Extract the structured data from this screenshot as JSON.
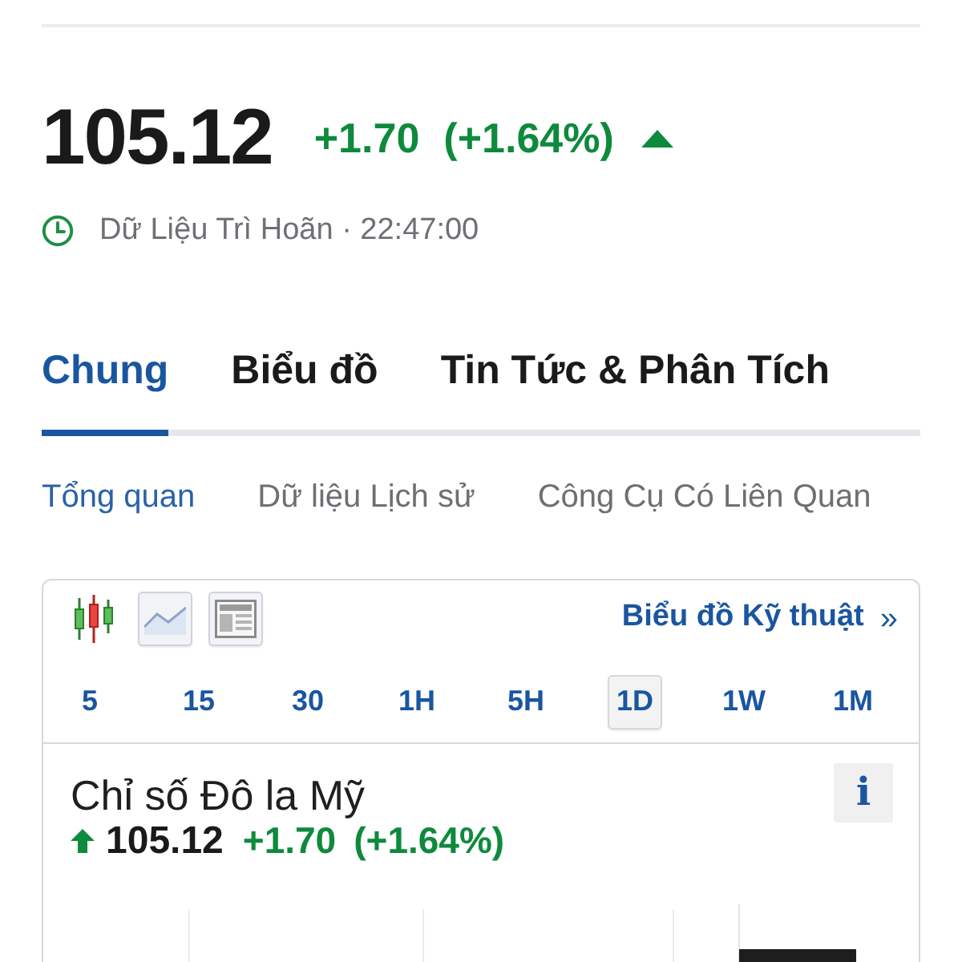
{
  "quote": {
    "price": "105.12",
    "change": "+1.70",
    "change_percent": "(+1.64%)",
    "rising": true
  },
  "status": {
    "label": "Dữ Liệu Trì Hoãn · 22:47:00"
  },
  "tabs": [
    {
      "label": "Chung",
      "selected": true
    },
    {
      "label": "Biểu đồ",
      "selected": false
    },
    {
      "label": "Tin Tức & Phân Tích",
      "selected": false
    }
  ],
  "subtabs": [
    {
      "label": "Tổng quan",
      "selected": true
    },
    {
      "label": "Dữ liệu Lịch sử",
      "selected": false
    },
    {
      "label": "Công Cụ Có Liên Quan",
      "selected": false
    }
  ],
  "chart_widget": {
    "chart_types": [
      {
        "kind": "candlestick",
        "selected": false
      },
      {
        "kind": "line",
        "selected": true
      },
      {
        "kind": "table",
        "selected": true
      }
    ],
    "technical_link": {
      "label": "Biểu đồ Kỹ thuật",
      "arrow": "»"
    },
    "timeframes": [
      {
        "label": "5",
        "selected": false
      },
      {
        "label": "15",
        "selected": false
      },
      {
        "label": "30",
        "selected": false
      },
      {
        "label": "1H",
        "selected": false
      },
      {
        "label": "5H",
        "selected": false
      },
      {
        "label": "1D",
        "selected": true
      },
      {
        "label": "1W",
        "selected": false
      },
      {
        "label": "1M",
        "selected": false
      }
    ],
    "instrument": {
      "name": "Chỉ số Đô la Mỹ",
      "info": "i",
      "price": "105.12",
      "change": "+1.70",
      "change_percent": "(+1.64%)",
      "rising": true
    }
  }
}
